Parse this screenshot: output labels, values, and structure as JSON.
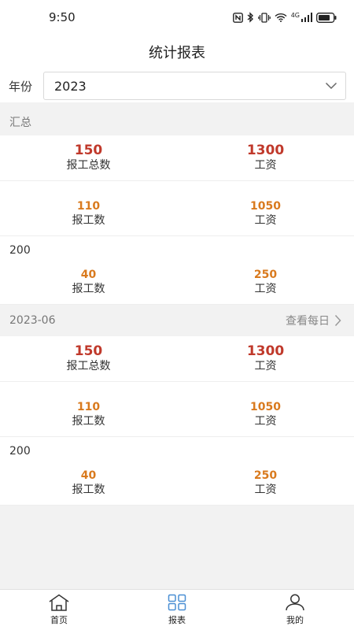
{
  "status": {
    "time": "9:50",
    "network": "4G"
  },
  "header": {
    "title": "统计报表"
  },
  "year_filter": {
    "label": "年份",
    "value": "2023"
  },
  "summary": {
    "title": "汇总",
    "total": {
      "count": "150",
      "count_label": "报工总数",
      "wage": "1300",
      "wage_label": "工资"
    },
    "row1": {
      "count": "110",
      "count_label": "报工数",
      "wage": "1050",
      "wage_label": "工资"
    },
    "group_title": "200",
    "row2": {
      "count": "40",
      "count_label": "报工数",
      "wage": "250",
      "wage_label": "工资"
    }
  },
  "month": {
    "title": "2023-06",
    "link_label": "查看每日",
    "total": {
      "count": "150",
      "count_label": "报工总数",
      "wage": "1300",
      "wage_label": "工资"
    },
    "row1": {
      "count": "110",
      "count_label": "报工数",
      "wage": "1050",
      "wage_label": "工资"
    },
    "group_title": "200",
    "row2": {
      "count": "40",
      "count_label": "报工数",
      "wage": "250",
      "wage_label": "工资"
    }
  },
  "tabbar": {
    "items": [
      {
        "label": "首页",
        "icon": "home-icon"
      },
      {
        "label": "报表",
        "icon": "grid-icon",
        "active": true
      },
      {
        "label": "我的",
        "icon": "user-icon"
      }
    ],
    "active_color": "#4a8fd4"
  }
}
